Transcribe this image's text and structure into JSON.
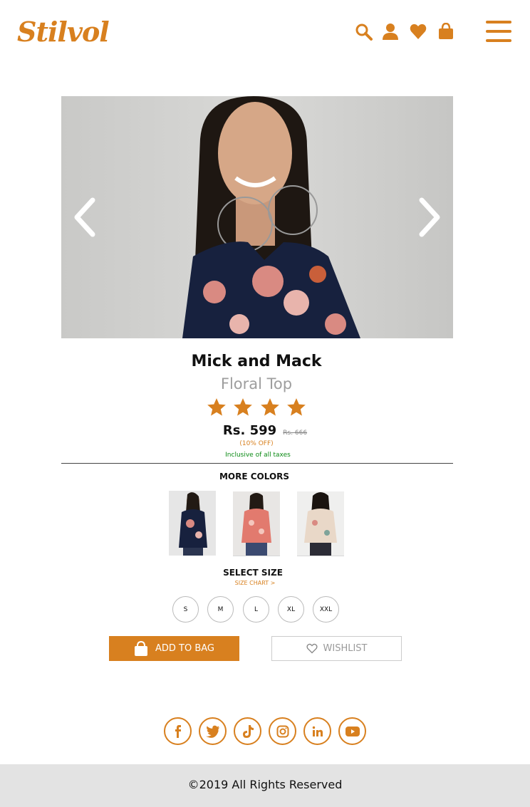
{
  "header": {
    "logo": "Stilvol",
    "icons": [
      "search-icon",
      "user-icon",
      "heart-icon",
      "bag-icon",
      "menu-icon"
    ]
  },
  "colors": {
    "accent": "#d8801f",
    "green": "#0a8a14",
    "footer_bg": "#e3e3e3"
  },
  "product": {
    "brand": "Mick and Mack",
    "name": "Floral Top",
    "rating_stars": 4,
    "price": "Rs. 599",
    "mrp": "Rs. 666",
    "discount": "(10% OFF)",
    "tax_note": "Inclusive of all taxes"
  },
  "more_colors": {
    "title": "MORE COLORS",
    "swatches": [
      "navy-floral",
      "coral-floral",
      "beige-floral"
    ]
  },
  "sizes": {
    "title": "SELECT SIZE",
    "chart_link": "SIZE CHART >",
    "options": [
      "S",
      "M",
      "L",
      "XL",
      "XXL"
    ]
  },
  "actions": {
    "add_to_bag": "ADD TO BAG",
    "wishlist": "WISHLIST"
  },
  "socials": [
    "facebook-icon",
    "twitter-icon",
    "tiktok-icon",
    "instagram-icon",
    "linkedin-icon",
    "youtube-icon"
  ],
  "footer": {
    "copyright": "©2019 All Rights Reserved"
  }
}
